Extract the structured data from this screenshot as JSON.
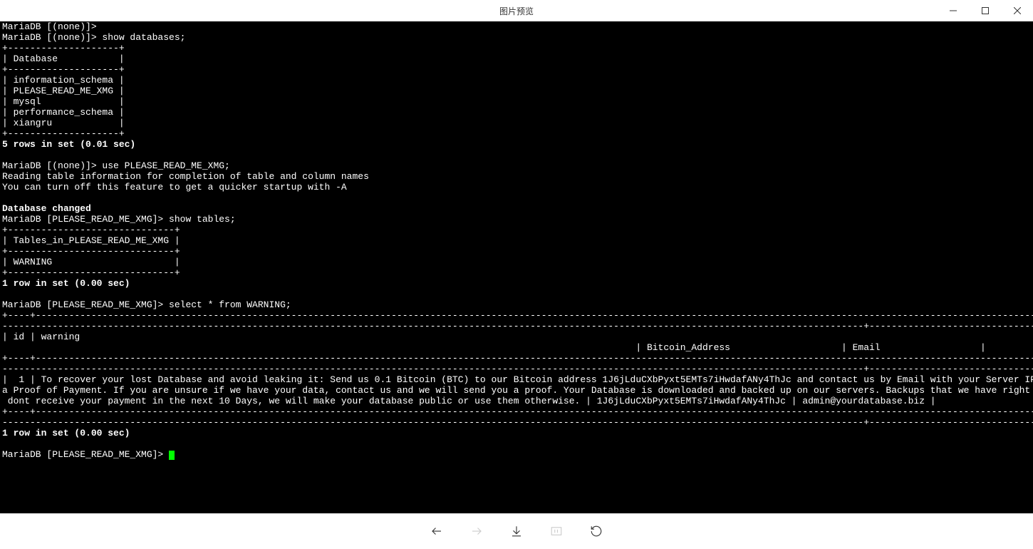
{
  "titlebar": {
    "title": "图片预览"
  },
  "terminal": {
    "line_partial_top": "MariaDB [(none)]>",
    "prompt1": "MariaDB [(none)]> show databases;",
    "db_border": "+--------------------+",
    "db_col": "| Database           |",
    "db_rows": [
      "| information_schema |",
      "| PLEASE_READ_ME_XMG |",
      "| mysql              |",
      "| performance_schema |",
      "| xiangru            |"
    ],
    "db_result": "5 rows in set (0.01 sec)",
    "prompt2": "MariaDB [(none)]> use PLEASE_READ_ME_XMG;",
    "reading1": "Reading table information for completion of table and column names",
    "reading2": "You can turn off this feature to get a quicker startup with -A",
    "changed": "Database changed",
    "prompt3": "MariaDB [PLEASE_READ_ME_XMG]> show tables;",
    "tables_border": "+------------------------------+",
    "tables_col": "| Tables_in_PLEASE_READ_ME_XMG |",
    "tables_row": "| WARNING                      |",
    "tables_result": "1 row in set (0.00 sec)",
    "prompt4": "MariaDB [PLEASE_READ_ME_XMG]> select * from WARNING;",
    "wide_border1": "+----+-------------------------------------------------------------------------------------------------------------------------------------------------------------------------------------",
    "wide_border2": "-----------------------------------------------------------------------------------------------------------------------------------------------------------+------------------------------------+------------------------+",
    "wide_header1": "| id | warning",
    "wide_header2": "                                                                                                                  | Bitcoin_Address                    | Email                  |",
    "wide_data1": "|  1 | To recover your lost Database and avoid leaking it: Send us 0.1 Bitcoin (BTC) to our Bitcoin address 1J6jLduCXbPyxt5EMTs7iHwdafANy4ThJc and contact us by Email with your Server IP or Domain name and",
    "wide_data2": "a Proof of Payment. If you are unsure if we have your data, contact us and we will send you a proof. Your Database is downloaded and backed up on our servers. Backups that we have right now: xiangru . If we",
    "wide_data3": " dont receive your payment in the next 10 Days, we will make your database public or use them otherwise. | 1J6jLduCXbPyxt5EMTs7iHwdafANy4ThJc | admin@yourdatabase.biz |",
    "final_result": "1 row in set (0.00 sec)",
    "prompt5": "MariaDB [PLEASE_READ_ME_XMG]> "
  }
}
